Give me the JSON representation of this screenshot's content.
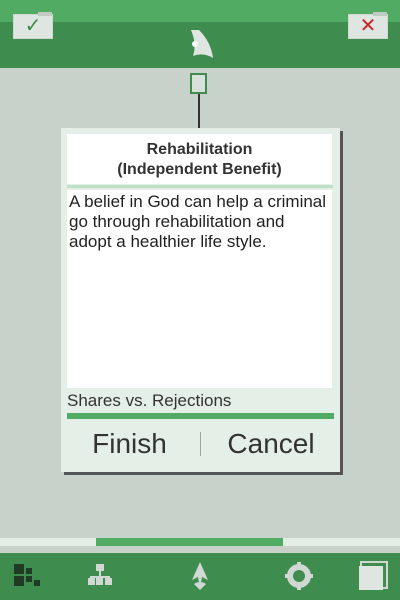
{
  "theme": {
    "accent": "#52ab63",
    "bar": "#3e8d4f",
    "background": "#c7d2cb",
    "reject": "#c62828"
  },
  "toolbar": {
    "accept_icon": "checkmark-icon",
    "reject_icon": "x-icon",
    "accept_glyph": "✓",
    "reject_glyph": "✕"
  },
  "dialog": {
    "title_line1": "Rehabilitation",
    "title_line2": "(Independent Benefit)",
    "body": "A belief in God can help a criminal go through rehabilitation and adopt a healthier life style.",
    "shares_label": "Shares vs. Rejections",
    "finish_label": "Finish",
    "cancel_label": "Cancel"
  },
  "bottom_nav": {
    "items": [
      "layout-icon",
      "hierarchy-icon",
      "logo-icon",
      "settings-icon",
      "window-icon"
    ]
  }
}
